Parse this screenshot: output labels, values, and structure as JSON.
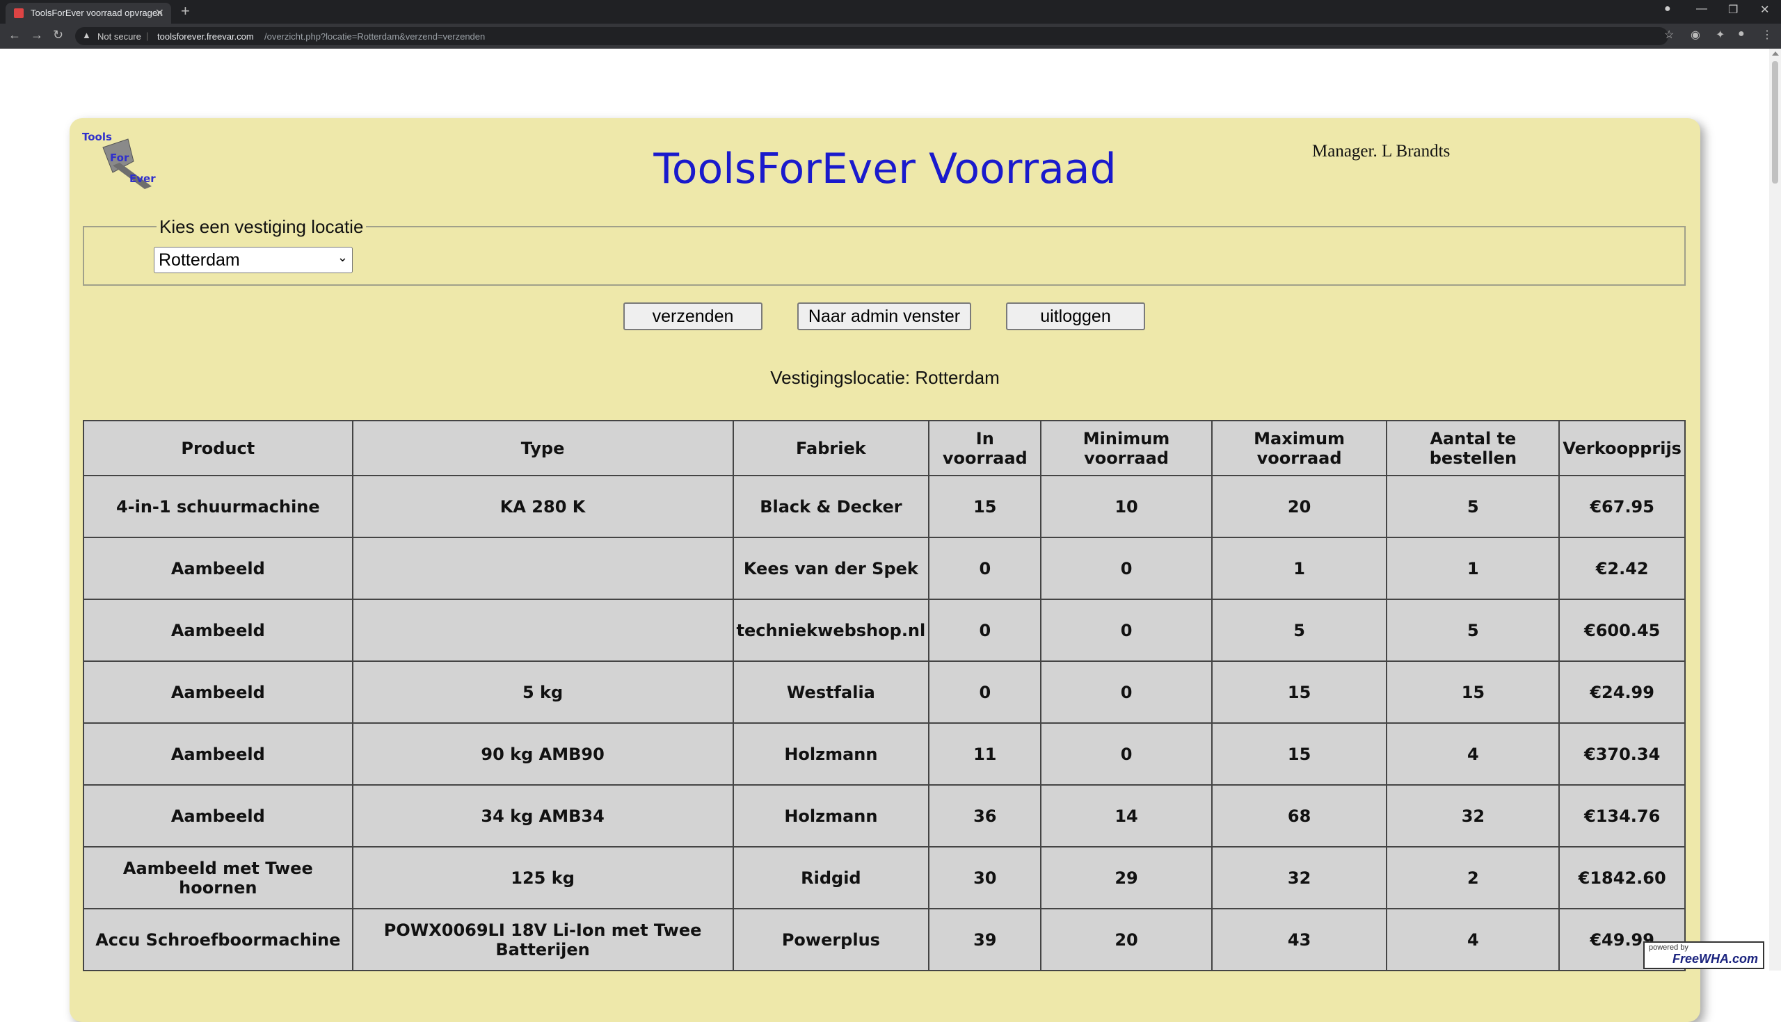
{
  "browser": {
    "tab_title": "ToolsForEver voorraad opvragen",
    "not_secure": "Not secure",
    "url_host": "toolsforever.freevar.com",
    "url_path": "/overzicht.php?locatie=Rotterdam&verzend=verzenden"
  },
  "page": {
    "logo_text": [
      "Tools",
      "For",
      "Ever"
    ],
    "title": "ToolsForEver Voorraad",
    "manager": "Manager. L Brandts",
    "legend": "Kies een vestiging locatie",
    "selected_location": "Rotterdam",
    "buttons": {
      "submit": "verzenden",
      "admin": "Naar admin venster",
      "logout": "uitloggen"
    },
    "location_label": "Vestigingslocatie: Rotterdam"
  },
  "table": {
    "headers": [
      "Product",
      "Type",
      "Fabriek",
      "In voorraad",
      "Minimum voorraad",
      "Maximum voorraad",
      "Aantal te bestellen",
      "Verkoopprijs"
    ],
    "rows": [
      [
        "4-in-1 schuurmachine",
        "KA 280 K",
        "Black & Decker",
        "15",
        "10",
        "20",
        "5",
        "€67.95"
      ],
      [
        "Aambeeld",
        "",
        "Kees van der Spek",
        "0",
        "0",
        "1",
        "1",
        "€2.42"
      ],
      [
        "Aambeeld",
        "",
        "techniekwebshop.nl",
        "0",
        "0",
        "5",
        "5",
        "€600.45"
      ],
      [
        "Aambeeld",
        "5 kg",
        "Westfalia",
        "0",
        "0",
        "15",
        "15",
        "€24.99"
      ],
      [
        "Aambeeld",
        "90 kg AMB90",
        "Holzmann",
        "11",
        "0",
        "15",
        "4",
        "€370.34"
      ],
      [
        "Aambeeld",
        "34 kg AMB34",
        "Holzmann",
        "36",
        "14",
        "68",
        "32",
        "€134.76"
      ],
      [
        "Aambeeld met Twee hoornen",
        "125 kg",
        "Ridgid",
        "30",
        "29",
        "32",
        "2",
        "€1842.60"
      ],
      [
        "Accu Schroefboormachine",
        "POWX0069LI 18V Li-Ion met Twee Batterijen",
        "Powerplus",
        "39",
        "20",
        "43",
        "4",
        "€49.99"
      ]
    ]
  },
  "badge": {
    "powered": "powered by",
    "name": "FreeWHA.com"
  }
}
